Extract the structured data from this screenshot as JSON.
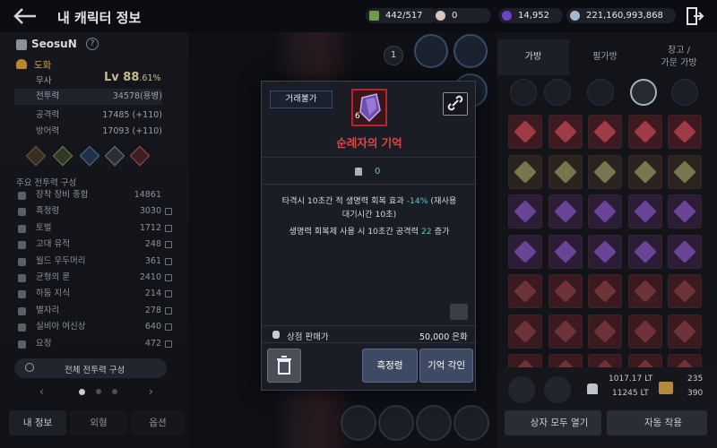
{
  "header": {
    "title": "내 캐릭터 정보"
  },
  "currency": [
    {
      "name": "energy",
      "value": "442/517",
      "color": "#8fc46a"
    },
    {
      "name": "pearl",
      "value": "0",
      "color": "#d9c7c2"
    },
    {
      "name": "crystal",
      "value": "14,952",
      "color": "#7b52d6"
    },
    {
      "name": "silver",
      "value": "221,160,993,868",
      "color": "#b9c7dd"
    }
  ],
  "character": {
    "name": "SeosuN",
    "guild": "도화",
    "class": "무사",
    "level": "Lv 88",
    "level_pct": ".61%"
  },
  "stats": [
    {
      "label": "전투력",
      "value": "34578(용병)"
    },
    {
      "label": "공격력",
      "value": "17485 (+110)"
    },
    {
      "label": "방어력",
      "value": "17093 (+110)"
    }
  ],
  "power_section": {
    "title": "주요 전투력 구성",
    "items": [
      {
        "label": "장착 장비 종합",
        "value": "14861"
      },
      {
        "label": "흑정령",
        "value": "3030"
      },
      {
        "label": "토벌",
        "value": "1712"
      },
      {
        "label": "고대 유적",
        "value": "248"
      },
      {
        "label": "월드 우두머리",
        "value": "361"
      },
      {
        "label": "균형의 룬",
        "value": "2410"
      },
      {
        "label": "하둠 지식",
        "value": "214"
      },
      {
        "label": "별자리",
        "value": "278"
      },
      {
        "label": "실비아 여신상",
        "value": "640"
      },
      {
        "label": "요정",
        "value": "472"
      }
    ],
    "all_button": "전체 전투력 구성"
  },
  "bottom_tabs": [
    "내 정보",
    "외형",
    "옵션"
  ],
  "slot_number": "1",
  "right_tabs": [
    "가방",
    "펄가방",
    "창고 /\n가문 가방"
  ],
  "weight": {
    "current": "1017.17 LT",
    "max": "11245 LT",
    "c1": "235",
    "c2": "390"
  },
  "right_buttons": {
    "open_all": "상자 모두 열기",
    "auto_equip": "자동 착용"
  },
  "modal": {
    "tag": "거래불가",
    "item_name": "순례자의 기억",
    "item_count_small": "6",
    "count": "0",
    "desc1_a": "타격시 10초간 적 생명력 회복 효과 ",
    "desc1_b": "-14%",
    "desc1_c": " (재사용",
    "desc2": "대기시간 10초)",
    "desc3_a": "생명력 회복제 사용 시 10초간 공격력 ",
    "desc3_b": "22",
    "desc3_c": " 증가",
    "sell_label": "상점 판매가",
    "sell_value": "50,000 은화",
    "btn_spirit": "흑정령",
    "btn_engrave": "기억 각인"
  }
}
